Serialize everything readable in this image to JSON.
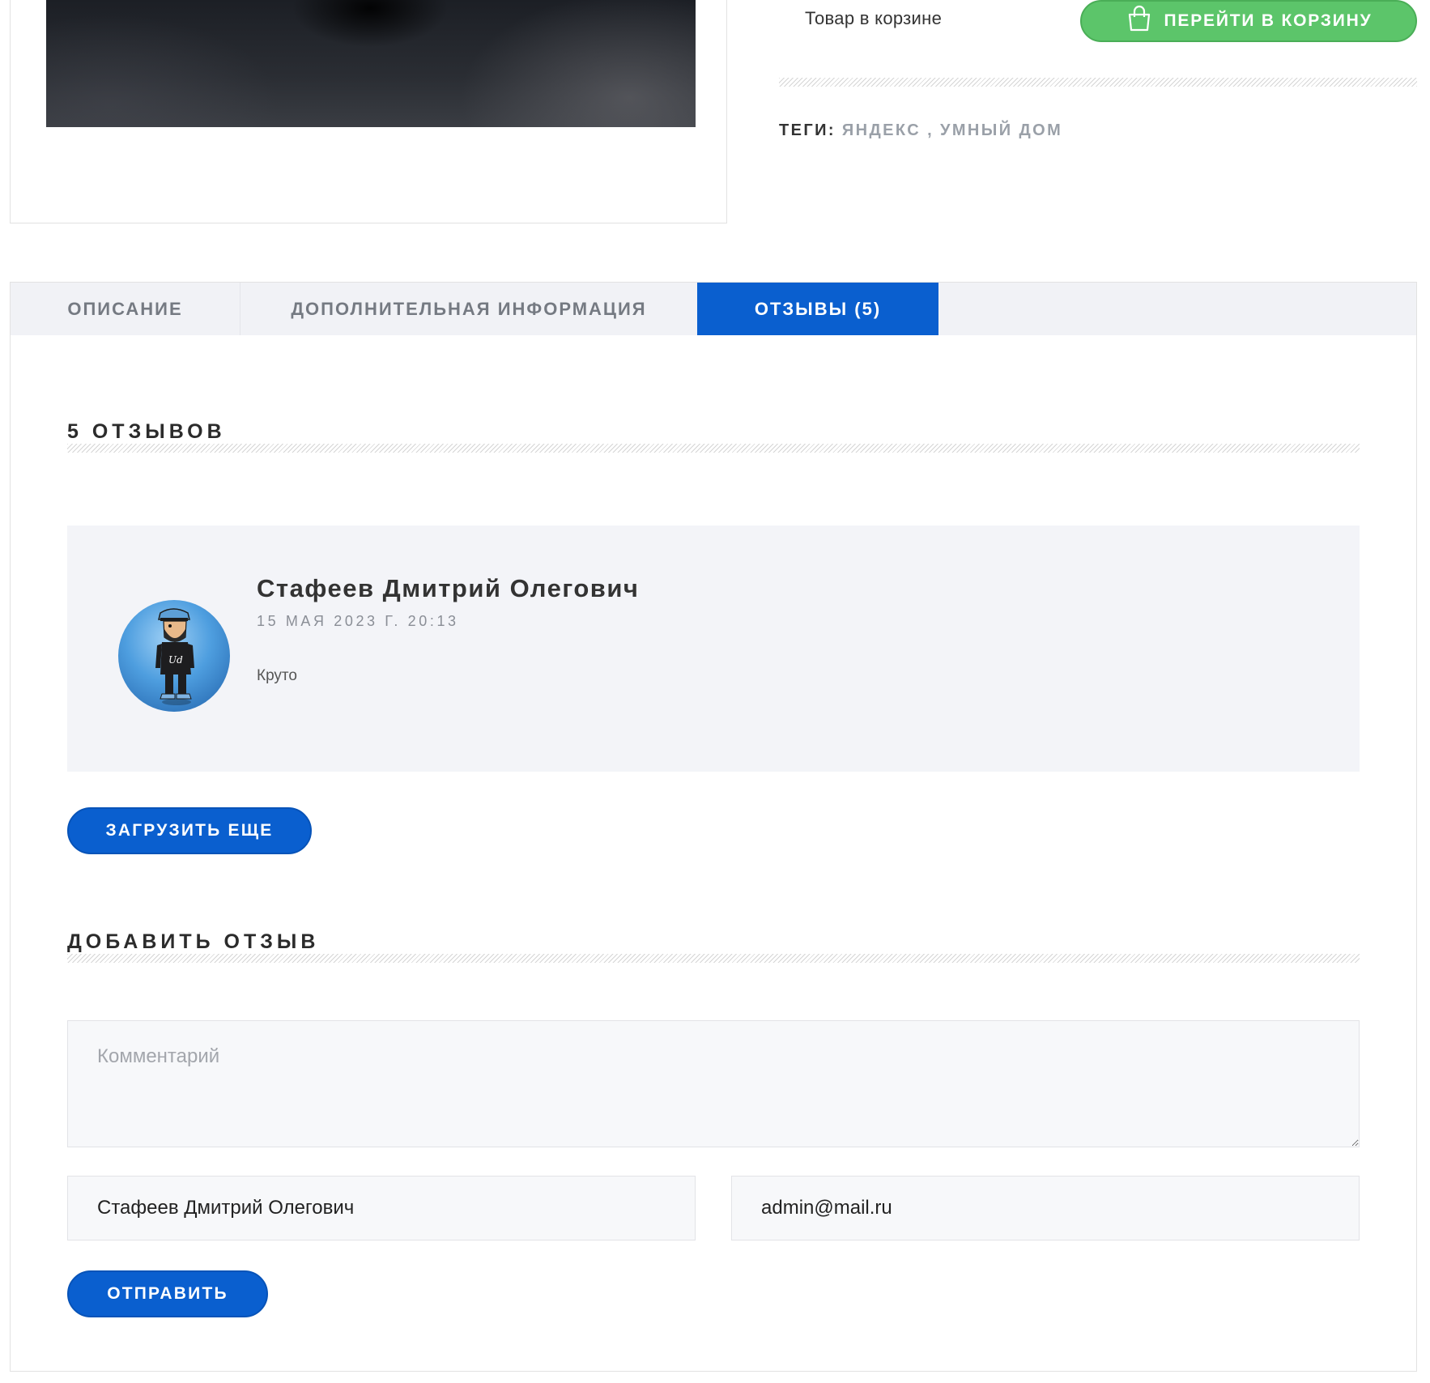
{
  "product": {
    "cart_status": "Товар в корзине",
    "cart_button_label": "ПЕРЕЙТИ В КОРЗИНУ",
    "tags_label": "ТЕГИ:",
    "tags": [
      "ЯНДЕКС",
      "УМНЫЙ ДОМ"
    ],
    "tags_separator": ","
  },
  "tabs": [
    {
      "label": "ОПИСАНИЕ",
      "active": false
    },
    {
      "label": "ДОПОЛНИТЕЛЬНАЯ ИНФОРМАЦИЯ",
      "active": false
    },
    {
      "label": "ОТЗЫВЫ (5)",
      "active": true
    }
  ],
  "reviews": {
    "heading": "5 ОТЗЫВОВ",
    "items": [
      {
        "author": "Стафеев Дмитрий Олегович",
        "date": "15 МАЯ 2023 Г. 20:13",
        "text": "Круто"
      }
    ],
    "load_more_label": "ЗАГРУЗИТЬ ЕЩЕ"
  },
  "review_form": {
    "heading": "ДОБАВИТЬ ОТЗЫВ",
    "comment_placeholder": "Комментарий",
    "name_value": "Стафеев Дмитрий Олегович",
    "email_value": "admin@mail.ru",
    "submit_label": "ОТПРАВИТЬ"
  },
  "colors": {
    "primary": "#0a5fcf",
    "cart_button": "#5cc56a",
    "tab_bar": "#f1f2f6",
    "review_card": "#f3f4f8"
  },
  "icons": {
    "cart_button": "shopping-bag-icon",
    "textarea_resize": "resize-handle-icon"
  }
}
